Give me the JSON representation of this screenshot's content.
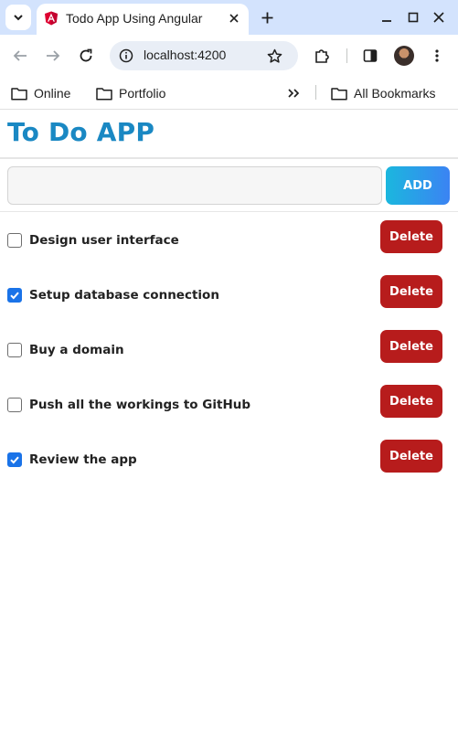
{
  "browser": {
    "tab_title": "Todo App Using Angular",
    "url": "localhost:4200",
    "bookmarks": [
      "Online",
      "Portfolio"
    ],
    "all_bookmarks_label": "All Bookmarks"
  },
  "app": {
    "title": "To Do APP",
    "input_value": "",
    "add_label": "ADD",
    "delete_label": "Delete",
    "todos": [
      {
        "text": "Design user interface",
        "done": false
      },
      {
        "text": "Setup database connection",
        "done": true
      },
      {
        "text": "Buy a domain",
        "done": false
      },
      {
        "text": "Push all the workings to GitHub",
        "done": false
      },
      {
        "text": "Review the app",
        "done": true
      }
    ]
  },
  "colors": {
    "title": "#1a88c3",
    "delete": "#b71c1c",
    "add_gradient_start": "#1bb7de",
    "add_gradient_end": "#3b83f3",
    "checkbox_checked": "#1a73e8"
  }
}
